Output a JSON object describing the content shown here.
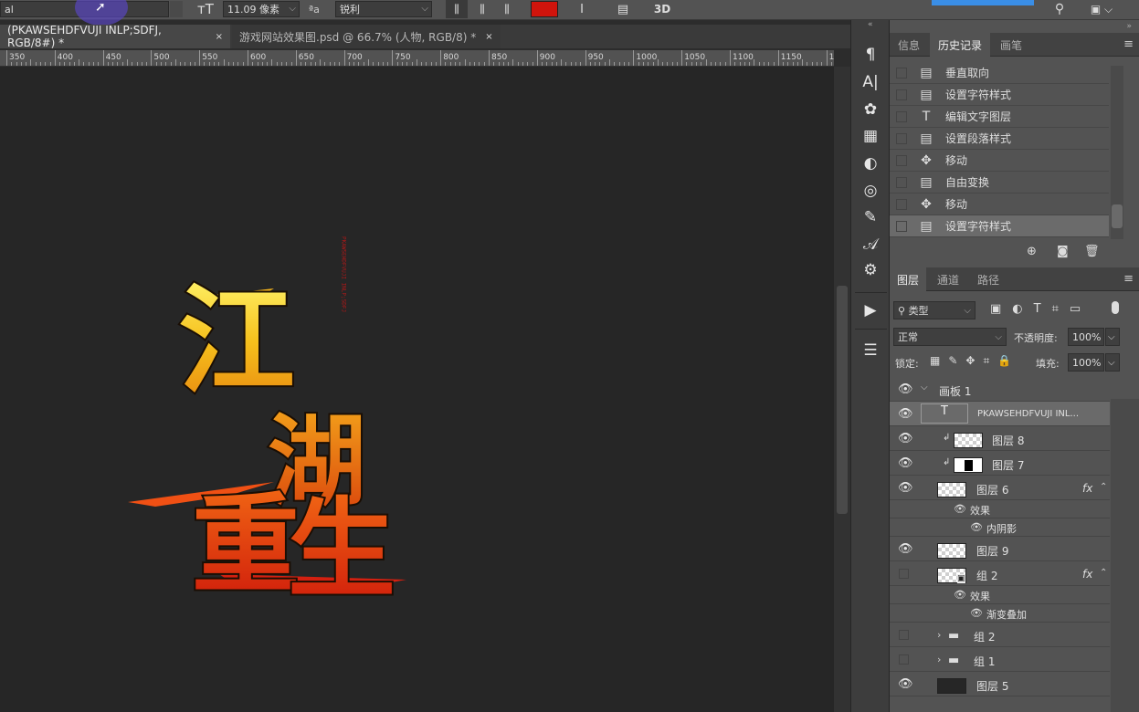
{
  "options_bar": {
    "font_family_value": "al",
    "font_size_value": "11.09 像素",
    "antialias_value": "锐利",
    "color_swatch": "#d0140c",
    "three_d_label": "3D",
    "aa_label": "ªa"
  },
  "tabs": [
    {
      "label": "(PKAWSEHDFVUJI INLP;SDFJ, RGB/8#) *",
      "close": "×"
    },
    {
      "label": "游戏网站效果图.psd @ 66.7% (人物, RGB/8) *",
      "close": "×"
    }
  ],
  "ruler": {
    "labels": [
      "350",
      "400",
      "450",
      "500",
      "550",
      "600",
      "650",
      "700",
      "750",
      "800",
      "850",
      "900",
      "950",
      "1000",
      "1050",
      "1100",
      "1150",
      "1200"
    ]
  },
  "canvas": {
    "title_chars": [
      "江",
      "湖",
      "重",
      "生"
    ],
    "vertical_text": "PKAWSEHDFVUJI INLP;SDFJ"
  },
  "history_panel": {
    "tabs": [
      "信息",
      "历史记录",
      "画笔"
    ],
    "active_tab": "历史记录",
    "items": [
      {
        "label": "垂直取向",
        "icon": "document-icon"
      },
      {
        "label": "设置字符样式",
        "icon": "document-icon"
      },
      {
        "label": "编辑文字图层",
        "icon": "type-icon"
      },
      {
        "label": "设置段落样式",
        "icon": "document-icon"
      },
      {
        "label": "移动",
        "icon": "move-icon"
      },
      {
        "label": "自由变换",
        "icon": "document-icon"
      },
      {
        "label": "移动",
        "icon": "move-icon"
      },
      {
        "label": "设置字符样式",
        "icon": "document-icon",
        "selected": true
      }
    ]
  },
  "layers_panel": {
    "tabs": [
      "图层",
      "通道",
      "路径"
    ],
    "active_tab": "图层",
    "filter_label": "类型",
    "blend_mode": "正常",
    "opacity_label": "不透明度:",
    "opacity_value": "100%",
    "lock_label": "锁定:",
    "fill_label": "填充:",
    "fill_value": "100%",
    "layers": [
      {
        "name": "画板 1",
        "kind": "artboard",
        "visible": true
      },
      {
        "name": "PKAWSEHDFVUJI INL...",
        "kind": "text",
        "visible": true,
        "selected": true
      },
      {
        "name": "图层 8",
        "kind": "clip",
        "visible": true
      },
      {
        "name": "图层 7",
        "kind": "clip-mask",
        "visible": true
      },
      {
        "name": "图层 6",
        "kind": "layer",
        "visible": true,
        "fx": true
      },
      {
        "name": "效果",
        "kind": "effects"
      },
      {
        "name": "内阴影",
        "kind": "effect"
      },
      {
        "name": "图层 9",
        "kind": "layer",
        "visible": true
      },
      {
        "name": "组 2",
        "kind": "smart",
        "visible": false,
        "fx": true
      },
      {
        "name": "效果",
        "kind": "effects"
      },
      {
        "name": "渐变叠加",
        "kind": "effect"
      },
      {
        "name": "组 2",
        "kind": "group",
        "visible": false
      },
      {
        "name": "组 1",
        "kind": "group",
        "visible": false
      },
      {
        "name": "图层 5",
        "kind": "dark",
        "visible": true
      }
    ],
    "fx_label": "fx"
  }
}
